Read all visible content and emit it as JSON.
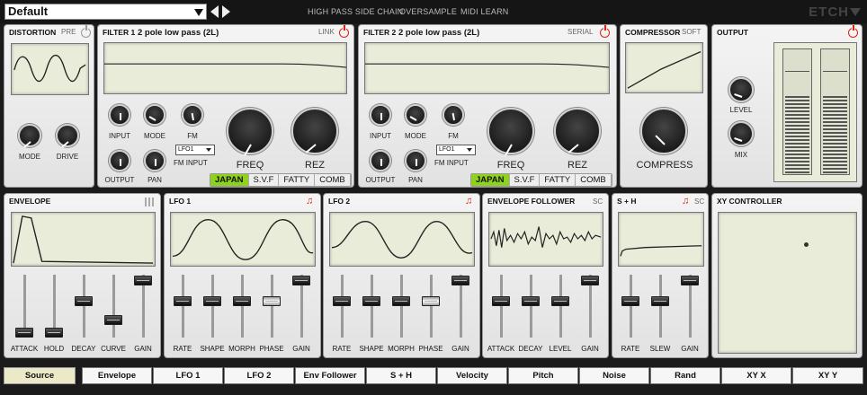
{
  "preset": {
    "name": "Default"
  },
  "top_menu": [
    "HIGH PASS SIDE CHAIN",
    "OVERSAMPLE",
    "MIDI LEARN"
  ],
  "brand": "ETCH",
  "distortion": {
    "title": "DISTORTION",
    "tag": "PRE",
    "knobs": [
      "MODE",
      "DRIVE"
    ]
  },
  "filter1": {
    "title": "FILTER 1",
    "type": "2 pole low pass (2L)",
    "tag": "LINK",
    "small_knobs": [
      "INPUT",
      "MODE",
      "FM",
      "OUTPUT",
      "PAN"
    ],
    "fm_input_value": "LFO1",
    "fm_input_label": "FM INPUT",
    "big_knobs": [
      "FREQ",
      "REZ"
    ],
    "modes": [
      "JAPAN",
      "S.V.F",
      "FATTY",
      "COMB"
    ],
    "active_mode": "JAPAN"
  },
  "filter2": {
    "title": "FILTER 2",
    "type": "2 pole low pass (2L)",
    "tag": "SERIAL",
    "small_knobs": [
      "INPUT",
      "MODE",
      "FM",
      "OUTPUT",
      "PAN"
    ],
    "fm_input_value": "LFO1",
    "fm_input_label": "FM INPUT",
    "big_knobs": [
      "FREQ",
      "REZ"
    ],
    "modes": [
      "JAPAN",
      "S.V.F",
      "FATTY",
      "COMB"
    ],
    "active_mode": "JAPAN"
  },
  "compressor": {
    "title": "COMPRESSOR",
    "tag": "SOFT",
    "knob": "COMPRESS"
  },
  "output": {
    "title": "OUTPUT",
    "knobs": [
      "LEVEL",
      "MIX"
    ]
  },
  "envelope": {
    "title": "ENVELOPE",
    "sliders": [
      {
        "label": "ATTACK",
        "value": 0.08
      },
      {
        "label": "HOLD",
        "value": 0.08
      },
      {
        "label": "DECAY",
        "value": 0.62
      },
      {
        "label": "CURVE",
        "value": 0.3
      },
      {
        "label": "GAIN",
        "value": 0.98
      }
    ]
  },
  "lfo1": {
    "title": "LFO 1",
    "sliders": [
      {
        "label": "RATE",
        "value": 0.62
      },
      {
        "label": "SHAPE",
        "value": 0.62
      },
      {
        "label": "MORPH",
        "value": 0.62
      },
      {
        "label": "PHASE",
        "value": 0.62
      },
      {
        "label": "GAIN",
        "value": 0.98
      }
    ]
  },
  "lfo2": {
    "title": "LFO 2",
    "sliders": [
      {
        "label": "RATE",
        "value": 0.62
      },
      {
        "label": "SHAPE",
        "value": 0.62
      },
      {
        "label": "MORPH",
        "value": 0.62
      },
      {
        "label": "PHASE",
        "value": 0.62
      },
      {
        "label": "GAIN",
        "value": 0.98
      }
    ]
  },
  "envfollower": {
    "title": "ENVELOPE FOLLOWER",
    "tag": "SC",
    "sliders": [
      {
        "label": "ATTACK",
        "value": 0.62
      },
      {
        "label": "DECAY",
        "value": 0.62
      },
      {
        "label": "LEVEL",
        "value": 0.62
      },
      {
        "label": "GAIN",
        "value": 0.98
      }
    ]
  },
  "sh": {
    "title": "S + H",
    "tag": "SC",
    "sliders": [
      {
        "label": "RATE",
        "value": 0.62
      },
      {
        "label": "SLEW",
        "value": 0.62
      },
      {
        "label": "GAIN",
        "value": 0.98
      }
    ]
  },
  "xy": {
    "title": "XY CONTROLLER"
  },
  "mod_tabs": [
    "Source",
    "Envelope",
    "LFO 1",
    "LFO 2",
    "Env Follower",
    "S + H",
    "Velocity",
    "Pitch",
    "Noise",
    "Rand",
    "XY X",
    "XY Y"
  ],
  "mod_active": "Source",
  "colors": {
    "accent_green": "#8fd21e",
    "power_red": "#d21111"
  }
}
